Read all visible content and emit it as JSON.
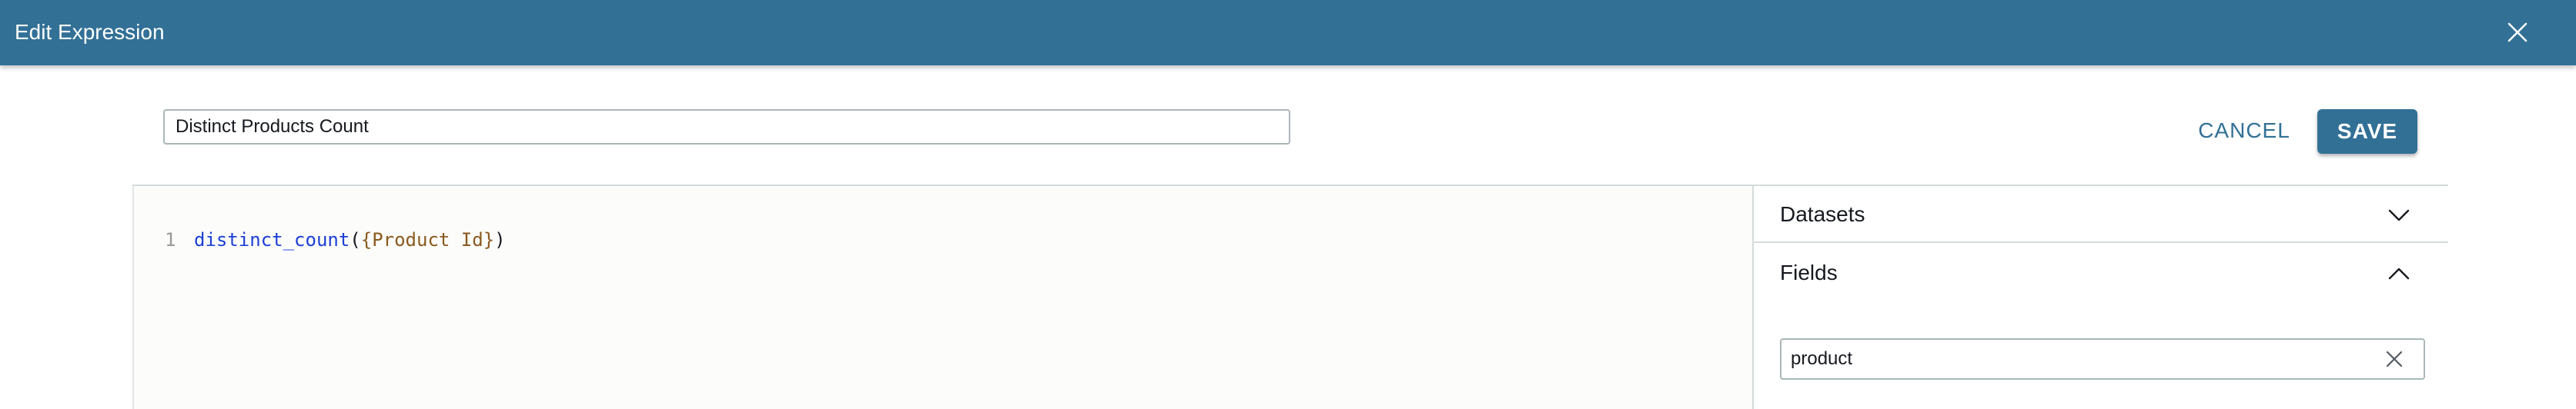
{
  "header": {
    "title": "Edit Expression",
    "close_icon": "close-icon",
    "background_color": "#327096"
  },
  "expression_name": {
    "value": "Distinct Products Count"
  },
  "actions": {
    "cancel_label": "CANCEL",
    "save_label": "SAVE"
  },
  "editor": {
    "lines": [
      {
        "number": "1",
        "function": "distinct_count",
        "open_paren": "(",
        "field": "{Product Id}",
        "close_paren": ")"
      }
    ]
  },
  "side_panel": {
    "datasets": {
      "label": "Datasets",
      "icon": "chevron-down-icon"
    },
    "fields": {
      "label": "Fields",
      "icon": "chevron-up-icon",
      "filter_value": "product",
      "clear_icon": "clear-icon"
    }
  }
}
